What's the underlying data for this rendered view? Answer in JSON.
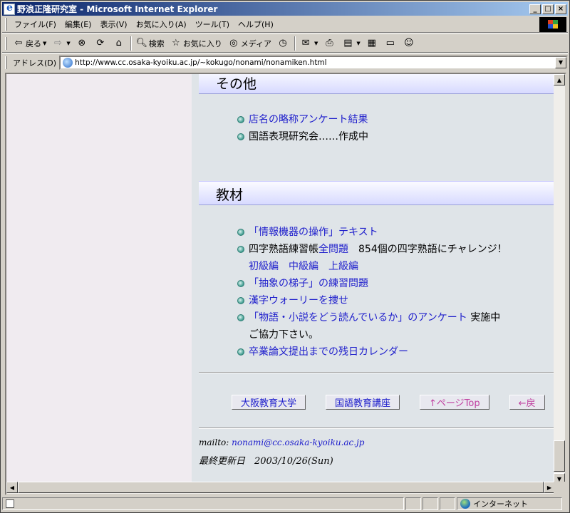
{
  "window": {
    "title": "野浪正隆研究室 - Microsoft Internet Explorer",
    "controls": [
      "_",
      "□",
      "×"
    ]
  },
  "menu": [
    "ファイル(F)",
    "編集(E)",
    "表示(V)",
    "お気に入り(A)",
    "ツール(T)",
    "ヘルプ(H)"
  ],
  "toolbar": {
    "back": "戻る",
    "search": "検索",
    "favorites": "お気に入り",
    "media": "メディア"
  },
  "address": {
    "label": "アドレス(D)",
    "url": "http://www.cc.osaka-kyoiku.ac.jp/~kokugo/nonami/nonamiken.html"
  },
  "content": {
    "section_other": {
      "title": "その他",
      "items": [
        {
          "text": "店名の略称アンケート結果",
          "link": true
        },
        {
          "text": "国語表現研究会……作成中",
          "link": false
        }
      ]
    },
    "section_materials": {
      "title": "教材",
      "item1": "「情報機器の操作」テキスト",
      "item2_prefix": "四字熟語練習帳",
      "item2_link": "全問題",
      "item2_suffix": "854個の四字熟語にチャレンジ！",
      "item2_sub": [
        "初級編",
        "中級編",
        "上級編"
      ],
      "item3": "「抽象の梯子」の練習問題",
      "item4": "漢字ウォーリーを捜せ",
      "item5_link": "「物語・小説をどう読んでいるか」のアンケート",
      "item5_suffix": "実施中",
      "item5_line2": "ご協力下さい。",
      "item6": "卒業論文提出までの残日カレンダー"
    },
    "nav_buttons": [
      "大阪教育大学",
      "国語教育講座",
      "↑ページTop",
      "←戻"
    ],
    "mailto_label": "mailto:",
    "mailto_address": "nonami@cc.osaka-kyoiku.ac.jp",
    "updated": "最終更新日　2003/10/26(Sun)"
  },
  "status": {
    "zone": "インターネット"
  }
}
